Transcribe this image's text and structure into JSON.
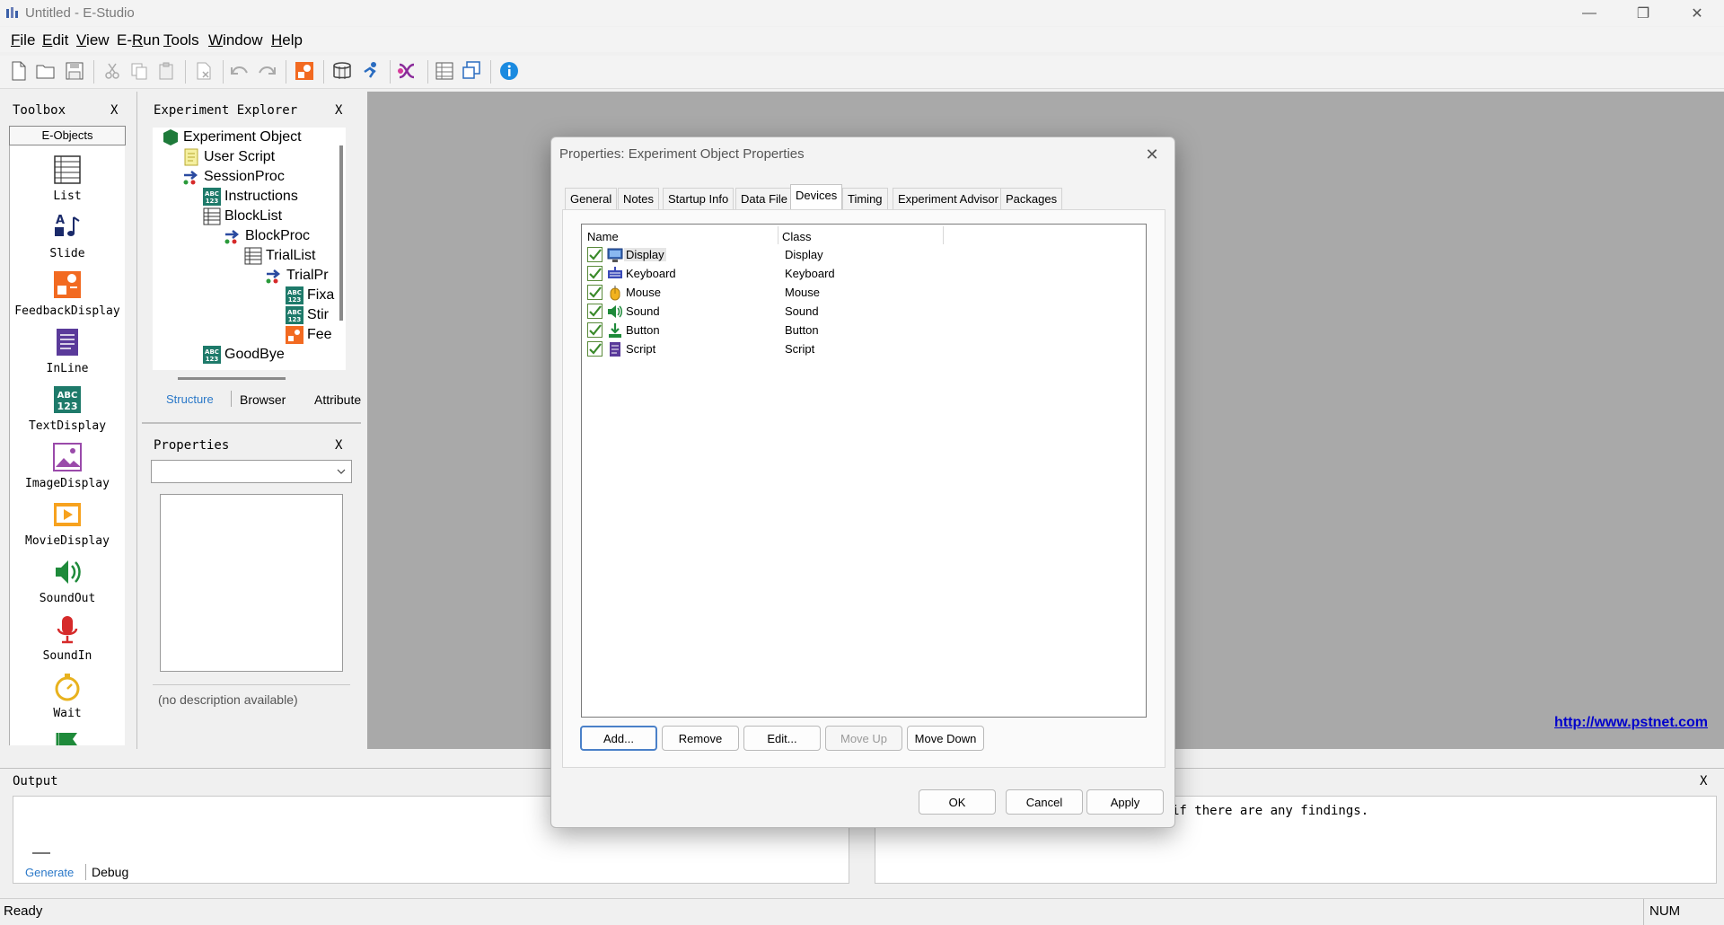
{
  "window": {
    "title": "Untitled - E-Studio"
  },
  "menu": [
    {
      "pre": "",
      "acc": "F",
      "post": "ile"
    },
    {
      "pre": "",
      "acc": "E",
      "post": "dit"
    },
    {
      "pre": "",
      "acc": "V",
      "post": "iew"
    },
    {
      "pre": "E-",
      "acc": "R",
      "post": "un"
    },
    {
      "pre": "",
      "acc": "T",
      "post": "ools"
    },
    {
      "pre": "",
      "acc": "W",
      "post": "indow"
    },
    {
      "pre": "",
      "acc": "H",
      "post": "elp"
    }
  ],
  "toolbar_icons": [
    "new-file-icon",
    "open-folder-icon",
    "save-icon",
    "cut-icon",
    "copy-icon",
    "paste-icon",
    "delete-icon",
    "undo-icon",
    "redo-icon",
    "feedback-icon",
    "compile-icon",
    "run-icon",
    "merge-icon",
    "grid-icon",
    "windows-icon",
    "info-icon"
  ],
  "toolbox": {
    "title": "Toolbox",
    "close": "X",
    "tab": "E-Objects",
    "items": [
      "List",
      "Slide",
      "FeedbackDisplay",
      "InLine",
      "TextDisplay",
      "ImageDisplay",
      "MovieDisplay",
      "SoundOut",
      "SoundIn",
      "Wait"
    ]
  },
  "explorer": {
    "title": "Experiment Explorer",
    "close": "X",
    "nodes": [
      "Experiment Object",
      "User Script",
      "SessionProc",
      "Instructions",
      "BlockList",
      "BlockProc",
      "TrialList",
      "TrialPr",
      "Fixa",
      "Stir",
      "Fee",
      "GoodBye"
    ],
    "tabs": [
      "Structure",
      "Browser",
      "Attribute"
    ]
  },
  "properties": {
    "title": "Properties",
    "close": "X",
    "description": "(no description available)"
  },
  "workspace": {
    "link": "http://www.pstnet.com"
  },
  "output": {
    "title": "Output",
    "tabs": [
      "Generate",
      "Debug"
    ],
    "advisor_close": "X",
    "advisor_text": "if there are any findings."
  },
  "status": {
    "text": "Ready",
    "num": "NUM"
  },
  "dialog": {
    "title": "Properties: Experiment Object Properties",
    "close": "✕",
    "tabs": [
      "General",
      "Notes",
      "Startup Info",
      "Data File",
      "Devices",
      "Timing",
      "Experiment Advisor",
      "Packages"
    ],
    "active_tab": "Devices",
    "columns": {
      "name": "Name",
      "class": "Class"
    },
    "devices": [
      {
        "name": "Display",
        "class": "Display",
        "checked": true
      },
      {
        "name": "Keyboard",
        "class": "Keyboard",
        "checked": true
      },
      {
        "name": "Mouse",
        "class": "Mouse",
        "checked": true
      },
      {
        "name": "Sound",
        "class": "Sound",
        "checked": true
      },
      {
        "name": "Button",
        "class": "Button",
        "checked": true
      },
      {
        "name": "Script",
        "class": "Script",
        "checked": true
      }
    ],
    "buttons": {
      "add": "Add...",
      "remove": "Remove",
      "edit": "Edit...",
      "move_up": "Move Up",
      "move_down": "Move Down",
      "ok": "OK",
      "cancel": "Cancel",
      "apply": "Apply"
    }
  }
}
